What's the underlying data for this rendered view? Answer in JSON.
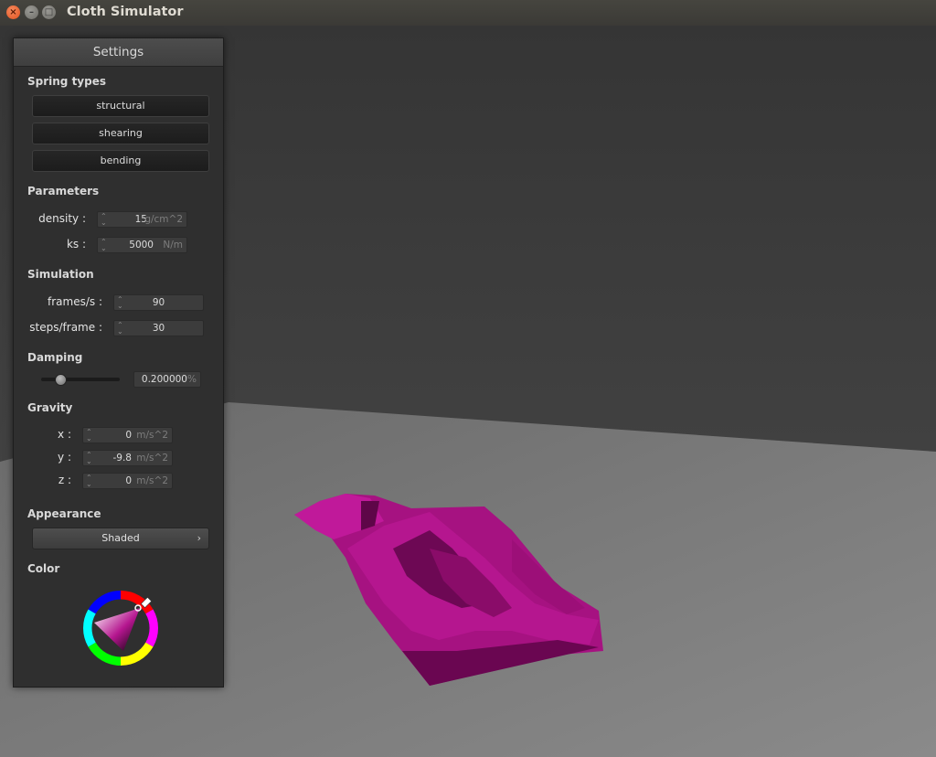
{
  "window": {
    "title": "Cloth Simulator"
  },
  "settings": {
    "header": "Settings",
    "spring_types": {
      "label": "Spring types",
      "buttons": [
        "structural",
        "shearing",
        "bending"
      ]
    },
    "parameters": {
      "label": "Parameters",
      "density": {
        "label": "density :",
        "value": "15",
        "unit": "g/cm^2"
      },
      "ks": {
        "label": "ks :",
        "value": "5000",
        "unit": "N/m"
      }
    },
    "simulation": {
      "label": "Simulation",
      "fps": {
        "label": "frames/s :",
        "value": "90"
      },
      "steps": {
        "label": "steps/frame :",
        "value": "30"
      }
    },
    "damping": {
      "label": "Damping",
      "slider_fraction": 0.2,
      "value": "0.200000",
      "unit": "%"
    },
    "gravity": {
      "label": "Gravity",
      "x": {
        "label": "x :",
        "value": "0",
        "unit": "m/s^2"
      },
      "y": {
        "label": "y :",
        "value": "-9.8",
        "unit": "m/s^2"
      },
      "z": {
        "label": "z :",
        "value": "0",
        "unit": "m/s^2"
      }
    },
    "appearance": {
      "label": "Appearance",
      "value": "Shaded"
    },
    "color": {
      "label": "Color",
      "cloth_color": "#b5168f"
    }
  }
}
